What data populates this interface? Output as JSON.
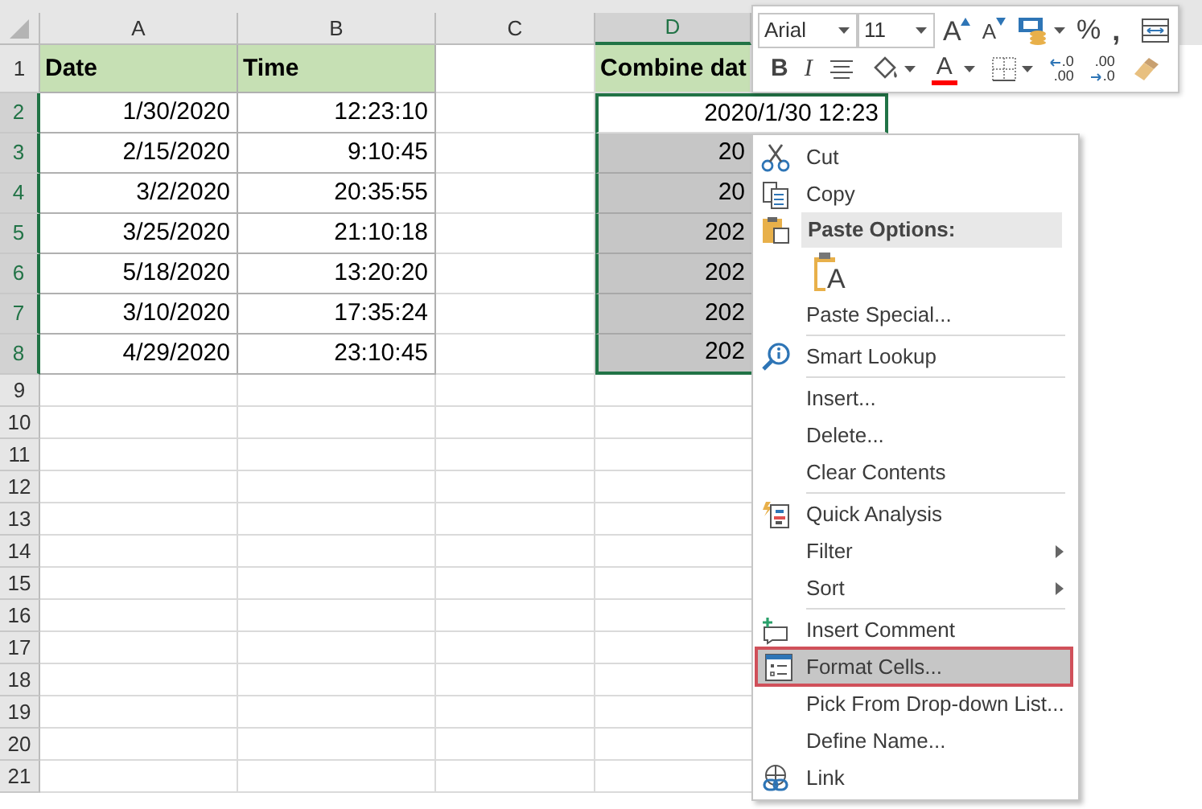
{
  "columns": [
    {
      "label": "A",
      "selected": false
    },
    {
      "label": "B",
      "selected": false
    },
    {
      "label": "C",
      "selected": false
    },
    {
      "label": "D",
      "selected": true
    }
  ],
  "header_row": {
    "number": "1",
    "a": "Date",
    "b": "Time",
    "d": "Combine dat"
  },
  "rows": [
    {
      "number": "2",
      "selected": true,
      "active": true,
      "a": "1/30/2020",
      "b": "12:23:10",
      "d": "2020/1/30 12:23"
    },
    {
      "number": "3",
      "selected": true,
      "active": false,
      "a": "2/15/2020",
      "b": "9:10:45",
      "d": "20"
    },
    {
      "number": "4",
      "selected": true,
      "active": false,
      "a": "3/2/2020",
      "b": "20:35:55",
      "d": "20"
    },
    {
      "number": "5",
      "selected": true,
      "active": false,
      "a": "3/25/2020",
      "b": "21:10:18",
      "d": "202"
    },
    {
      "number": "6",
      "selected": true,
      "active": false,
      "a": "5/18/2020",
      "b": "13:20:20",
      "d": "202"
    },
    {
      "number": "7",
      "selected": true,
      "active": false,
      "a": "3/10/2020",
      "b": "17:35:24",
      "d": "202"
    },
    {
      "number": "8",
      "selected": true,
      "active": false,
      "a": "4/29/2020",
      "b": "23:10:45",
      "d": "202"
    }
  ],
  "empty_rows": [
    "9",
    "10",
    "11",
    "12",
    "13",
    "14",
    "15",
    "16",
    "17",
    "18",
    "19",
    "20",
    "21"
  ],
  "mini_toolbar": {
    "font": "Arial",
    "size": "11",
    "grow_font": "A",
    "shrink_font": "A",
    "percent": "%",
    "comma": ",",
    "bold": "B",
    "italic": "I",
    "font_color_letter": "A",
    "increase_decimal": [
      ".0",
      ".00"
    ],
    "decrease_decimal": [
      ".00",
      ".0"
    ]
  },
  "context_menu": [
    {
      "kind": "item",
      "label": "Cut",
      "submenu": false,
      "selected": false
    },
    {
      "kind": "item",
      "label": "Copy",
      "submenu": false,
      "selected": false
    },
    {
      "kind": "header",
      "label": "Paste Options:"
    },
    {
      "kind": "paste_options",
      "glyph": "A"
    },
    {
      "kind": "item",
      "label": "Paste Special...",
      "submenu": false,
      "selected": false
    },
    {
      "kind": "separator"
    },
    {
      "kind": "item",
      "label": "Smart Lookup",
      "submenu": false,
      "selected": false
    },
    {
      "kind": "separator"
    },
    {
      "kind": "item",
      "label": "Insert...",
      "submenu": false,
      "selected": false
    },
    {
      "kind": "item",
      "label": "Delete...",
      "submenu": false,
      "selected": false
    },
    {
      "kind": "item",
      "label": "Clear Contents",
      "submenu": false,
      "selected": false
    },
    {
      "kind": "separator"
    },
    {
      "kind": "item",
      "label": "Quick Analysis",
      "submenu": false,
      "selected": false
    },
    {
      "kind": "item",
      "label": "Filter",
      "submenu": true,
      "selected": false
    },
    {
      "kind": "item",
      "label": "Sort",
      "submenu": true,
      "selected": false
    },
    {
      "kind": "separator"
    },
    {
      "kind": "item",
      "label": "Insert Comment",
      "submenu": false,
      "selected": false
    },
    {
      "kind": "item",
      "label": "Format Cells...",
      "submenu": false,
      "selected": true
    },
    {
      "kind": "item",
      "label": "Pick From Drop-down List...",
      "submenu": false,
      "selected": false
    },
    {
      "kind": "item",
      "label": "Define Name...",
      "submenu": false,
      "selected": false
    },
    {
      "kind": "item",
      "label": "Link",
      "submenu": false,
      "selected": false
    }
  ]
}
